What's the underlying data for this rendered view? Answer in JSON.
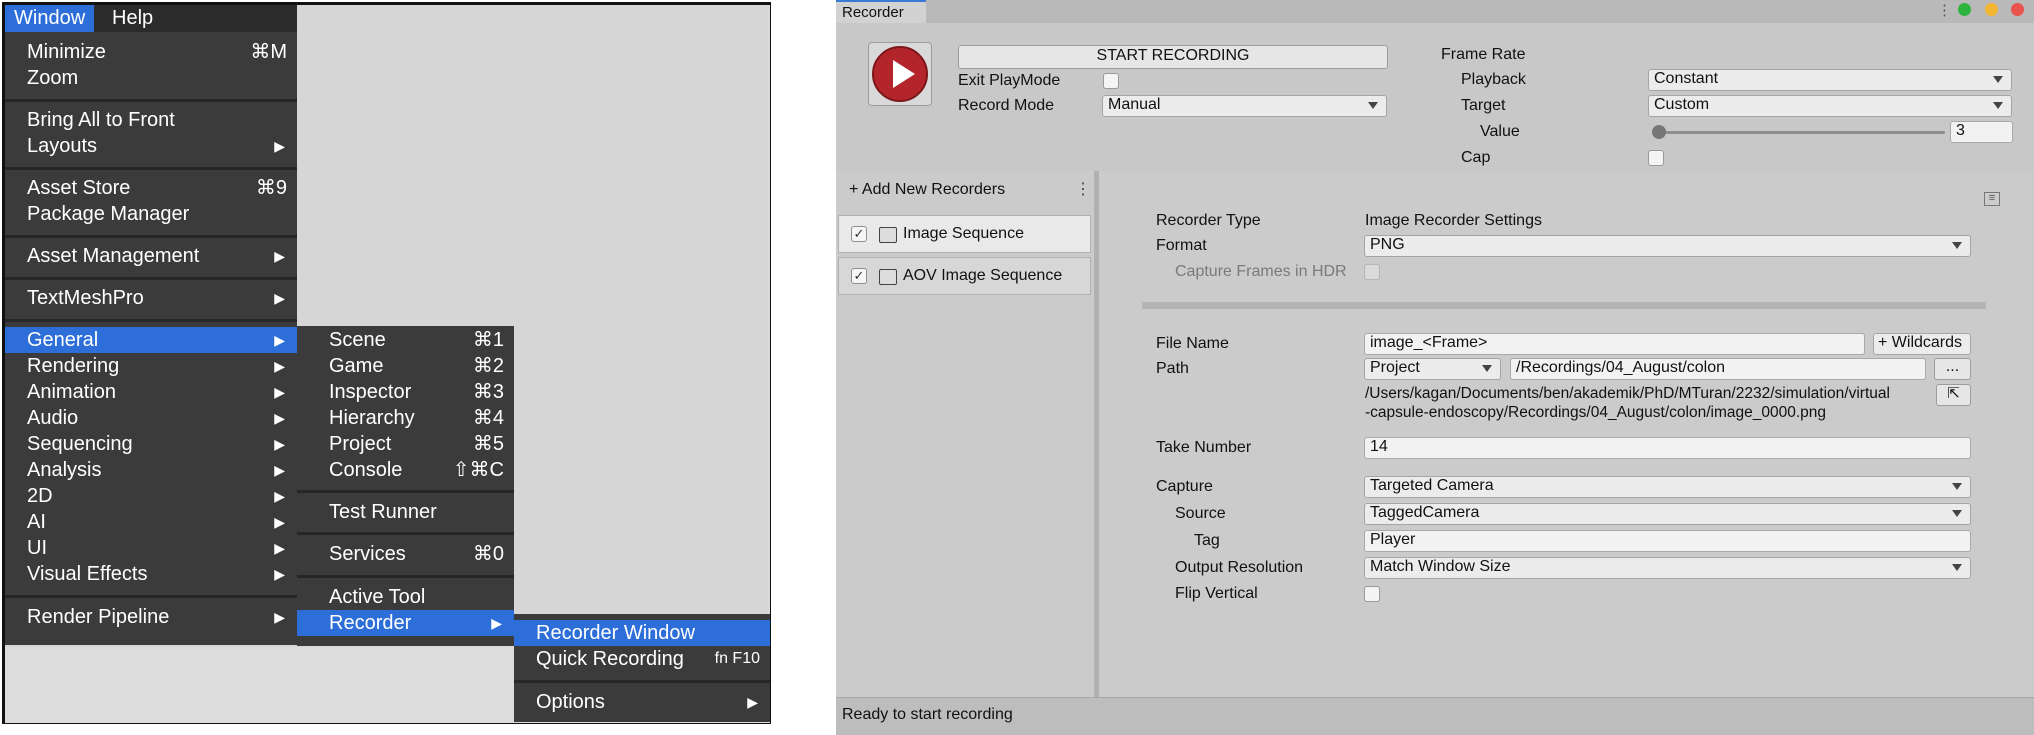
{
  "menubar": {
    "items": [
      "Window",
      "Help"
    ]
  },
  "window_menu": {
    "items": [
      {
        "label": "Minimize",
        "shortcut": "⌘M"
      },
      {
        "label": "Zoom",
        "shortcut": ""
      },
      {
        "label": "Bring All to Front",
        "shortcut": ""
      },
      {
        "label": "Layouts",
        "submenu": true
      },
      {
        "label": "Asset Store",
        "shortcut": "⌘9"
      },
      {
        "label": "Package Manager",
        "shortcut": ""
      },
      {
        "label": "Asset Management",
        "submenu": true
      },
      {
        "label": "TextMeshPro",
        "submenu": true
      },
      {
        "label": "General",
        "submenu": true
      },
      {
        "label": "Rendering",
        "submenu": true
      },
      {
        "label": "Animation",
        "submenu": true
      },
      {
        "label": "Audio",
        "submenu": true
      },
      {
        "label": "Sequencing",
        "submenu": true
      },
      {
        "label": "Analysis",
        "submenu": true
      },
      {
        "label": "2D",
        "submenu": true
      },
      {
        "label": "AI",
        "submenu": true
      },
      {
        "label": "UI",
        "submenu": true
      },
      {
        "label": "Visual Effects",
        "submenu": true
      },
      {
        "label": "Render Pipeline",
        "submenu": true
      }
    ],
    "highlighted": "General"
  },
  "general_menu": {
    "items": [
      {
        "label": "Scene",
        "shortcut": "⌘1"
      },
      {
        "label": "Game",
        "shortcut": "⌘2"
      },
      {
        "label": "Inspector",
        "shortcut": "⌘3"
      },
      {
        "label": "Hierarchy",
        "shortcut": "⌘4"
      },
      {
        "label": "Project",
        "shortcut": "⌘5"
      },
      {
        "label": "Console",
        "shortcut": "⇧⌘C"
      },
      {
        "label": "Test Runner",
        "shortcut": ""
      },
      {
        "label": "Services",
        "shortcut": "⌘0"
      },
      {
        "label": "Active Tool",
        "shortcut": ""
      },
      {
        "label": "Recorder",
        "submenu": true
      }
    ],
    "highlighted": "Recorder"
  },
  "recorder_menu": {
    "items": [
      {
        "label": "Recorder Window",
        "shortcut": ""
      },
      {
        "label": "Quick Recording",
        "shortcut": "fn F10"
      },
      {
        "label": "Options",
        "submenu": true
      }
    ],
    "highlighted": "Recorder Window"
  },
  "recorder_window": {
    "tab_title": "Recorder",
    "traffic_colors": [
      "#2fb53f",
      "#f2b632",
      "#e8534b"
    ],
    "start_button": "START RECORDING",
    "exit_playmode_label": "Exit PlayMode",
    "exit_playmode_checked": false,
    "record_mode_label": "Record Mode",
    "record_mode_value": "Manual",
    "frame_rate_label": "Frame Rate",
    "playback_label": "Playback",
    "playback_value": "Constant",
    "target_label": "Target",
    "target_value": "Custom",
    "value_label": "Value",
    "value_number": "3",
    "cap_label": "Cap",
    "cap_checked": false,
    "add_recorders_label": "+ Add New Recorders",
    "recorders": [
      {
        "name": "Image Sequence",
        "enabled": true,
        "selected": true
      },
      {
        "name": "AOV Image Sequence",
        "enabled": true,
        "selected": false
      }
    ],
    "settings": {
      "recorder_type_label": "Recorder Type",
      "recorder_type_value": "Image Recorder Settings",
      "format_label": "Format",
      "format_value": "PNG",
      "capture_hdr_label": "Capture Frames in HDR",
      "file_name_label": "File Name",
      "file_name_value": "image_<Frame>",
      "wildcards_label": "+ Wildcards",
      "path_label": "Path",
      "path_root": "Project",
      "path_value": "/Recordings/04_August/colon",
      "browse_label": "...",
      "full_path_line1": "/Users/kagan/Documents/ben/akademik/PhD/MTuran/2232/simulation/virtual",
      "full_path_line2": "-capsule-endoscopy/Recordings/04_August/colon/image_0000.png",
      "take_number_label": "Take Number",
      "take_number_value": "14",
      "capture_label": "Capture",
      "capture_value": "Targeted Camera",
      "source_label": "Source",
      "source_value": "TaggedCamera",
      "tag_label": "Tag",
      "tag_value": "Player",
      "output_resolution_label": "Output Resolution",
      "output_resolution_value": "Match Window Size",
      "flip_vertical_label": "Flip Vertical",
      "flip_vertical_checked": false
    },
    "status_text": "Ready to start recording",
    "play_icon_color": "#b3252a"
  }
}
